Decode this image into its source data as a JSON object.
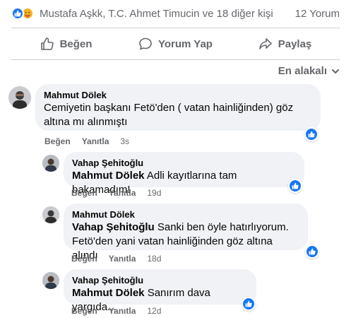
{
  "summary": {
    "reactions": [
      "like-icon",
      "care-icon"
    ],
    "names_text": "Mustafa Aşkk, T.C. Ahmet Timucin ve 18 diğer kişi",
    "comment_count_text": "12 Yorum"
  },
  "actions": {
    "like_label": "Beğen",
    "comment_label": "Yorum Yap",
    "share_label": "Paylaş"
  },
  "sort": {
    "label": "En alakalı"
  },
  "comments": [
    {
      "author": "Mahmut Dölek",
      "mention": "",
      "text_line1": "Cemiyetin başkanı Fetö'den ( vatan hainliğinden) göz",
      "text_line2": "altına mı alınmıştı",
      "like_label": "Beğen",
      "reply_label": "Yanıtla",
      "time": "3s"
    },
    {
      "author": "Vahap Şehitoğlu",
      "mention": "Mahmut Dölek",
      "text": "Adli kayıtlarına tam bakamadım!",
      "like_label": "Beğen",
      "reply_label": "Yanıtla",
      "time": "19d"
    },
    {
      "author": "Mahmut Dölek",
      "mention": "Vahap Şehitoğlu",
      "text": "Sanki ben öyle hatırlıyorum.",
      "text_line2": "Fetö'den yani vatan hainliğinden göz altına alındı",
      "like_label": "Beğen",
      "reply_label": "Yanıtla",
      "time": "18d"
    },
    {
      "author": "Vahap Şehitoğlu",
      "mention": "Mahmut Dölek",
      "text": "Sanırım dava yargıda...",
      "like_label": "Beğen",
      "reply_label": "Yanıtla",
      "time": "12d"
    }
  ],
  "colors": {
    "accent": "#1877f2",
    "secondary_text": "#65676b",
    "bubble": "#f0f2f5"
  }
}
